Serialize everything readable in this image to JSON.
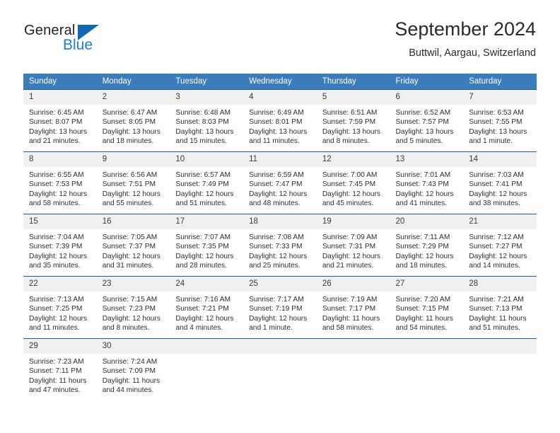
{
  "brand": {
    "name_part1": "General",
    "name_part2": "Blue",
    "triangle_icon": "triangle-icon"
  },
  "header": {
    "title": "September 2024",
    "location": "Buttwil, Aargau, Switzerland"
  },
  "colors": {
    "header_blue": "#3b7cbd",
    "row_border_blue": "#1a5fa0",
    "daynum_band": "#f0f0f0",
    "brand_blue": "#1b7fd4",
    "logo_triangle": "#1068b3"
  },
  "weekdays": [
    "Sunday",
    "Monday",
    "Tuesday",
    "Wednesday",
    "Thursday",
    "Friday",
    "Saturday"
  ],
  "weeks": [
    [
      {
        "day": "1",
        "sunrise": "Sunrise: 6:45 AM",
        "sunset": "Sunset: 8:07 PM",
        "daylight_1": "Daylight: 13 hours",
        "daylight_2": "and 21 minutes."
      },
      {
        "day": "2",
        "sunrise": "Sunrise: 6:47 AM",
        "sunset": "Sunset: 8:05 PM",
        "daylight_1": "Daylight: 13 hours",
        "daylight_2": "and 18 minutes."
      },
      {
        "day": "3",
        "sunrise": "Sunrise: 6:48 AM",
        "sunset": "Sunset: 8:03 PM",
        "daylight_1": "Daylight: 13 hours",
        "daylight_2": "and 15 minutes."
      },
      {
        "day": "4",
        "sunrise": "Sunrise: 6:49 AM",
        "sunset": "Sunset: 8:01 PM",
        "daylight_1": "Daylight: 13 hours",
        "daylight_2": "and 11 minutes."
      },
      {
        "day": "5",
        "sunrise": "Sunrise: 6:51 AM",
        "sunset": "Sunset: 7:59 PM",
        "daylight_1": "Daylight: 13 hours",
        "daylight_2": "and 8 minutes."
      },
      {
        "day": "6",
        "sunrise": "Sunrise: 6:52 AM",
        "sunset": "Sunset: 7:57 PM",
        "daylight_1": "Daylight: 13 hours",
        "daylight_2": "and 5 minutes."
      },
      {
        "day": "7",
        "sunrise": "Sunrise: 6:53 AM",
        "sunset": "Sunset: 7:55 PM",
        "daylight_1": "Daylight: 13 hours",
        "daylight_2": "and 1 minute."
      }
    ],
    [
      {
        "day": "8",
        "sunrise": "Sunrise: 6:55 AM",
        "sunset": "Sunset: 7:53 PM",
        "daylight_1": "Daylight: 12 hours",
        "daylight_2": "and 58 minutes."
      },
      {
        "day": "9",
        "sunrise": "Sunrise: 6:56 AM",
        "sunset": "Sunset: 7:51 PM",
        "daylight_1": "Daylight: 12 hours",
        "daylight_2": "and 55 minutes."
      },
      {
        "day": "10",
        "sunrise": "Sunrise: 6:57 AM",
        "sunset": "Sunset: 7:49 PM",
        "daylight_1": "Daylight: 12 hours",
        "daylight_2": "and 51 minutes."
      },
      {
        "day": "11",
        "sunrise": "Sunrise: 6:59 AM",
        "sunset": "Sunset: 7:47 PM",
        "daylight_1": "Daylight: 12 hours",
        "daylight_2": "and 48 minutes."
      },
      {
        "day": "12",
        "sunrise": "Sunrise: 7:00 AM",
        "sunset": "Sunset: 7:45 PM",
        "daylight_1": "Daylight: 12 hours",
        "daylight_2": "and 45 minutes."
      },
      {
        "day": "13",
        "sunrise": "Sunrise: 7:01 AM",
        "sunset": "Sunset: 7:43 PM",
        "daylight_1": "Daylight: 12 hours",
        "daylight_2": "and 41 minutes."
      },
      {
        "day": "14",
        "sunrise": "Sunrise: 7:03 AM",
        "sunset": "Sunset: 7:41 PM",
        "daylight_1": "Daylight: 12 hours",
        "daylight_2": "and 38 minutes."
      }
    ],
    [
      {
        "day": "15",
        "sunrise": "Sunrise: 7:04 AM",
        "sunset": "Sunset: 7:39 PM",
        "daylight_1": "Daylight: 12 hours",
        "daylight_2": "and 35 minutes."
      },
      {
        "day": "16",
        "sunrise": "Sunrise: 7:05 AM",
        "sunset": "Sunset: 7:37 PM",
        "daylight_1": "Daylight: 12 hours",
        "daylight_2": "and 31 minutes."
      },
      {
        "day": "17",
        "sunrise": "Sunrise: 7:07 AM",
        "sunset": "Sunset: 7:35 PM",
        "daylight_1": "Daylight: 12 hours",
        "daylight_2": "and 28 minutes."
      },
      {
        "day": "18",
        "sunrise": "Sunrise: 7:08 AM",
        "sunset": "Sunset: 7:33 PM",
        "daylight_1": "Daylight: 12 hours",
        "daylight_2": "and 25 minutes."
      },
      {
        "day": "19",
        "sunrise": "Sunrise: 7:09 AM",
        "sunset": "Sunset: 7:31 PM",
        "daylight_1": "Daylight: 12 hours",
        "daylight_2": "and 21 minutes."
      },
      {
        "day": "20",
        "sunrise": "Sunrise: 7:11 AM",
        "sunset": "Sunset: 7:29 PM",
        "daylight_1": "Daylight: 12 hours",
        "daylight_2": "and 18 minutes."
      },
      {
        "day": "21",
        "sunrise": "Sunrise: 7:12 AM",
        "sunset": "Sunset: 7:27 PM",
        "daylight_1": "Daylight: 12 hours",
        "daylight_2": "and 14 minutes."
      }
    ],
    [
      {
        "day": "22",
        "sunrise": "Sunrise: 7:13 AM",
        "sunset": "Sunset: 7:25 PM",
        "daylight_1": "Daylight: 12 hours",
        "daylight_2": "and 11 minutes."
      },
      {
        "day": "23",
        "sunrise": "Sunrise: 7:15 AM",
        "sunset": "Sunset: 7:23 PM",
        "daylight_1": "Daylight: 12 hours",
        "daylight_2": "and 8 minutes."
      },
      {
        "day": "24",
        "sunrise": "Sunrise: 7:16 AM",
        "sunset": "Sunset: 7:21 PM",
        "daylight_1": "Daylight: 12 hours",
        "daylight_2": "and 4 minutes."
      },
      {
        "day": "25",
        "sunrise": "Sunrise: 7:17 AM",
        "sunset": "Sunset: 7:19 PM",
        "daylight_1": "Daylight: 12 hours",
        "daylight_2": "and 1 minute."
      },
      {
        "day": "26",
        "sunrise": "Sunrise: 7:19 AM",
        "sunset": "Sunset: 7:17 PM",
        "daylight_1": "Daylight: 11 hours",
        "daylight_2": "and 58 minutes."
      },
      {
        "day": "27",
        "sunrise": "Sunrise: 7:20 AM",
        "sunset": "Sunset: 7:15 PM",
        "daylight_1": "Daylight: 11 hours",
        "daylight_2": "and 54 minutes."
      },
      {
        "day": "28",
        "sunrise": "Sunrise: 7:21 AM",
        "sunset": "Sunset: 7:13 PM",
        "daylight_1": "Daylight: 11 hours",
        "daylight_2": "and 51 minutes."
      }
    ],
    [
      {
        "day": "29",
        "sunrise": "Sunrise: 7:23 AM",
        "sunset": "Sunset: 7:11 PM",
        "daylight_1": "Daylight: 11 hours",
        "daylight_2": "and 47 minutes."
      },
      {
        "day": "30",
        "sunrise": "Sunrise: 7:24 AM",
        "sunset": "Sunset: 7:09 PM",
        "daylight_1": "Daylight: 11 hours",
        "daylight_2": "and 44 minutes."
      },
      {
        "day": "",
        "sunrise": "",
        "sunset": "",
        "daylight_1": "",
        "daylight_2": ""
      },
      {
        "day": "",
        "sunrise": "",
        "sunset": "",
        "daylight_1": "",
        "daylight_2": ""
      },
      {
        "day": "",
        "sunrise": "",
        "sunset": "",
        "daylight_1": "",
        "daylight_2": ""
      },
      {
        "day": "",
        "sunrise": "",
        "sunset": "",
        "daylight_1": "",
        "daylight_2": ""
      },
      {
        "day": "",
        "sunrise": "",
        "sunset": "",
        "daylight_1": "",
        "daylight_2": ""
      }
    ]
  ]
}
